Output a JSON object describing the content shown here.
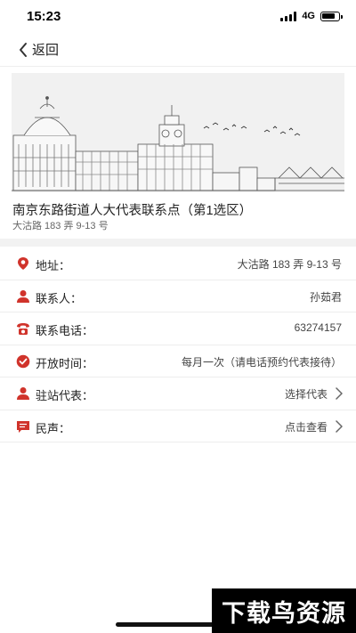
{
  "status_bar": {
    "time": "15:23",
    "network": "4G"
  },
  "nav": {
    "back_label": "返回"
  },
  "site": {
    "title": "南京东路街道人大代表联系点（第1选区）",
    "address_short": "大沽路 183 弄 9-13 号"
  },
  "rows": [
    {
      "icon": "location-pin-icon",
      "label": "地址：",
      "value": "大沽路 183 弄 9-13 号",
      "has_arrow": false
    },
    {
      "icon": "person-icon",
      "label": "联系人：",
      "value": "孙茹君",
      "has_arrow": false
    },
    {
      "icon": "phone-icon",
      "label": "联系电话：",
      "value": "63274157",
      "has_arrow": false
    },
    {
      "icon": "clock-icon",
      "label": "开放时间：",
      "value": "每月一次（请电话预约代表接待）",
      "has_arrow": false
    },
    {
      "icon": "person-icon",
      "label": "驻站代表：",
      "value": "选择代表",
      "has_arrow": true
    },
    {
      "icon": "chat-icon",
      "label": "民声：",
      "value": "点击查看",
      "has_arrow": true
    }
  ],
  "watermark": "下载鸟资源",
  "colors": {
    "accent": "#d0332b",
    "divider": "#ededed",
    "section_gap": "#f2f2f2"
  }
}
